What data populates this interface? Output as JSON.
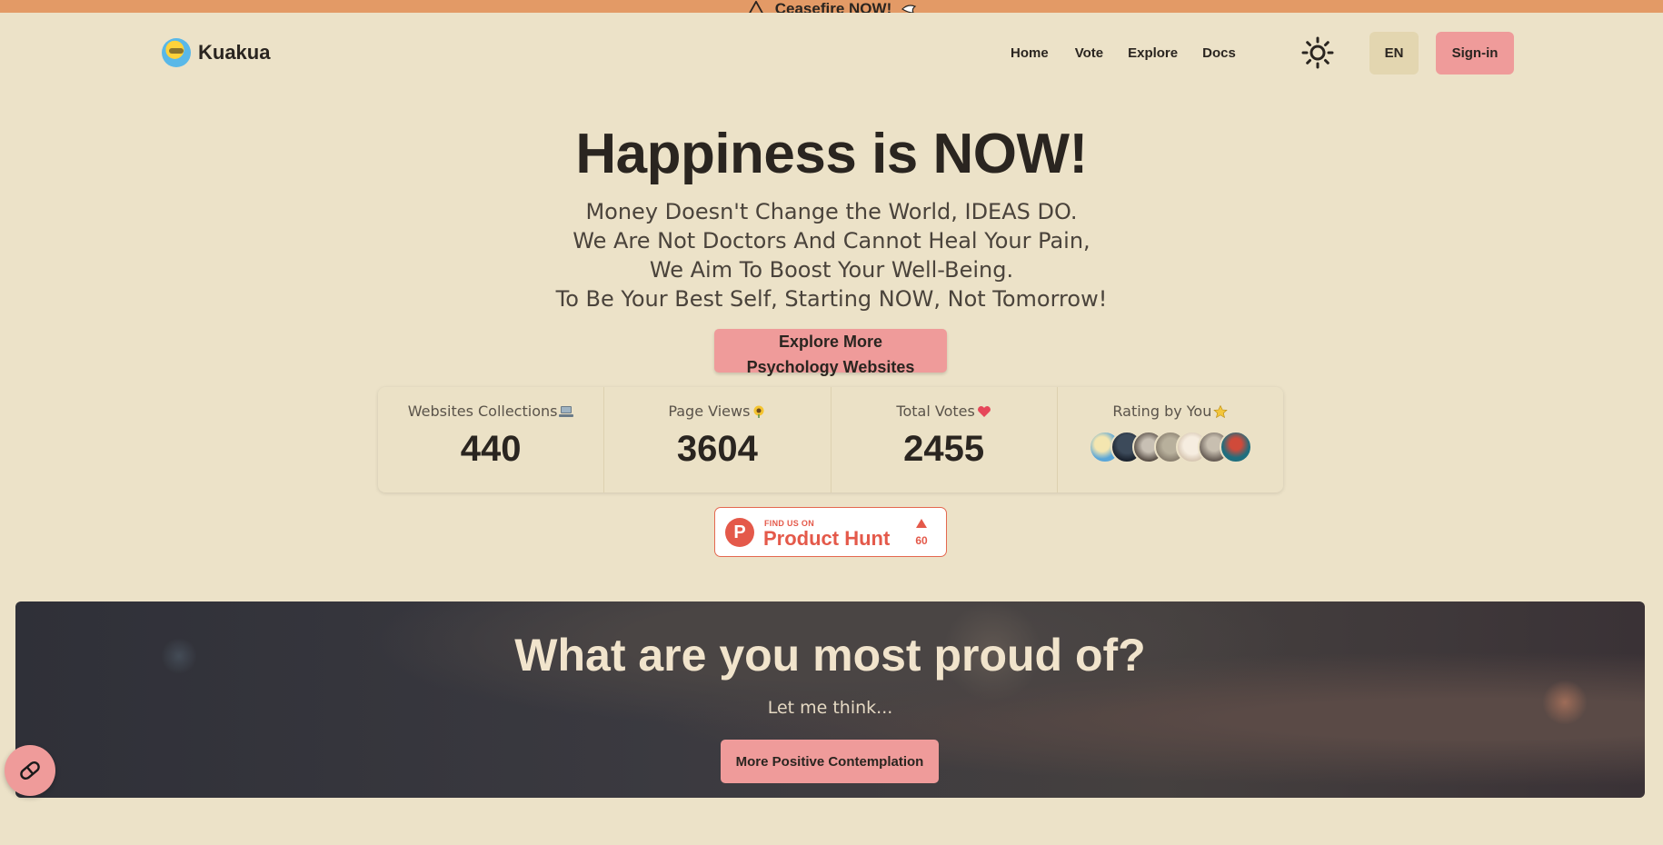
{
  "banner": {
    "text": "Ceasefire NOW!",
    "icon": "warning-icon",
    "trail_icon": "dove-icon"
  },
  "header": {
    "logo_text": "Kuakua",
    "logo_icon": "duck-logo-icon",
    "nav": [
      {
        "label": "Home"
      },
      {
        "label": "Vote"
      },
      {
        "label": "Explore"
      },
      {
        "label": "Docs"
      }
    ],
    "theme_icon": "sun-icon",
    "lang_label": "EN",
    "signin_label": "Sign-in"
  },
  "hero": {
    "title": "Happiness is NOW!",
    "lines": [
      "Money Doesn't Change the World, IDEAS DO.",
      "We Are Not Doctors And Cannot Heal Your Pain,",
      "We Aim To Boost Your Well-Being.",
      "To Be Your Best Self, Starting NOW, Not Tomorrow!"
    ],
    "explore_line1": "Explore More",
    "explore_line2": "Psychology Websites"
  },
  "stats": [
    {
      "label": "Websites Collections",
      "icon": "laptop-icon",
      "value": "440"
    },
    {
      "label": "Page Views",
      "icon": "sunflower-icon",
      "value": "3604"
    },
    {
      "label": "Total Votes",
      "icon": "heart-icon",
      "value": "2455"
    },
    {
      "label": "Rating by You",
      "icon": "star-icon",
      "avatars": 7
    }
  ],
  "product_hunt": {
    "small": "FIND US ON",
    "big": "Product Hunt",
    "letter": "P",
    "count": "60"
  },
  "feature": {
    "title": "What are you most proud of?",
    "subtitle": "Let me think...",
    "button_label": "More Positive Contemplation"
  },
  "colors": {
    "background": "#ece2c8",
    "accent": "#ef9b9a",
    "banner": "#e39a66",
    "dark": "#3b3a40"
  }
}
